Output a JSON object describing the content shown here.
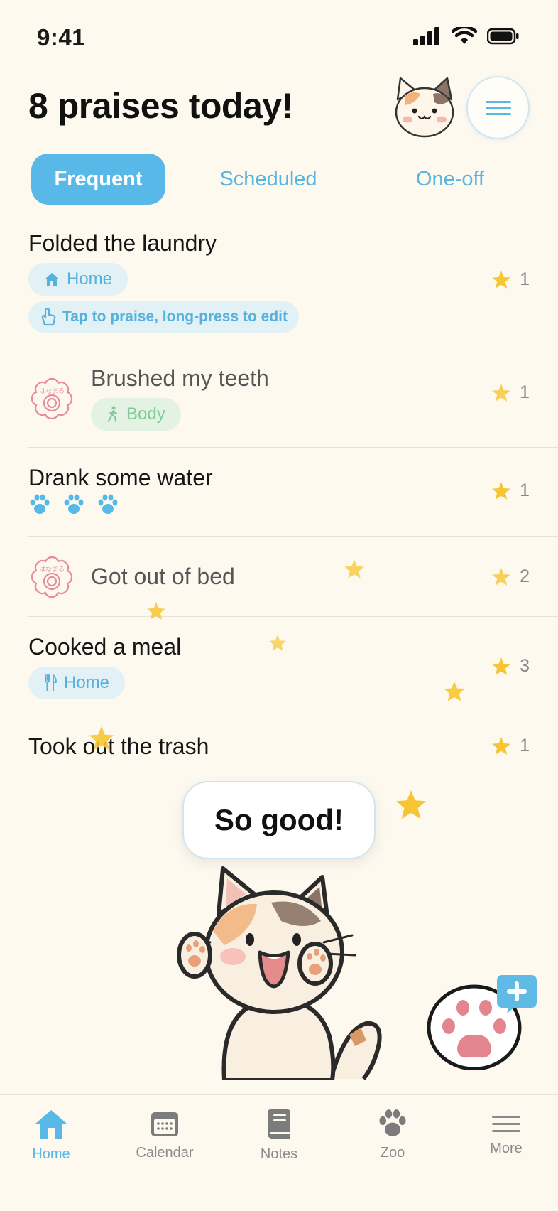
{
  "status_bar": {
    "time": "9:41"
  },
  "header": {
    "title": "8 praises today!"
  },
  "tabs": [
    {
      "label": "Frequent",
      "active": true
    },
    {
      "label": "Scheduled",
      "active": false
    },
    {
      "label": "One-off",
      "active": false
    }
  ],
  "items": [
    {
      "title": "Folded the laundry",
      "tag": {
        "label": "Home",
        "icon": "house-icon",
        "color": "#56b2dd"
      },
      "hint": "Tap to praise, long-press to edit",
      "count": "1",
      "done": false
    },
    {
      "title": "Brushed my teeth",
      "tag": {
        "label": "Body",
        "icon": "walking-person-icon",
        "color": "#82cc99"
      },
      "count": "1",
      "done": true,
      "stamp_text": "はなまる"
    },
    {
      "title": "Drank some water",
      "paws": 3,
      "count": "1",
      "done": false
    },
    {
      "title": "Got out of bed",
      "count": "2",
      "done": true,
      "stamp_text": "はなまる"
    },
    {
      "title": "Cooked a meal",
      "tag": {
        "label": "Home",
        "icon": "fork-knife-icon",
        "color": "#56b2dd"
      },
      "count": "3",
      "done": false
    },
    {
      "title": "Took out the trash",
      "count": "1",
      "done": false
    }
  ],
  "praise_bubble": {
    "text": "So good!"
  },
  "tab_bar": [
    {
      "label": "Home",
      "icon": "home-icon",
      "active": true
    },
    {
      "label": "Calendar",
      "icon": "calendar-icon",
      "active": false
    },
    {
      "label": "Notes",
      "icon": "notebook-icon",
      "active": false
    },
    {
      "label": "Zoo",
      "icon": "paw-icon",
      "active": false
    },
    {
      "label": "More",
      "icon": "menu-lines-icon",
      "active": false
    }
  ],
  "colors": {
    "accent": "#58b9e8",
    "star": "#f7c531",
    "background": "#fdf9ef",
    "stamp": "#e98a9e"
  }
}
